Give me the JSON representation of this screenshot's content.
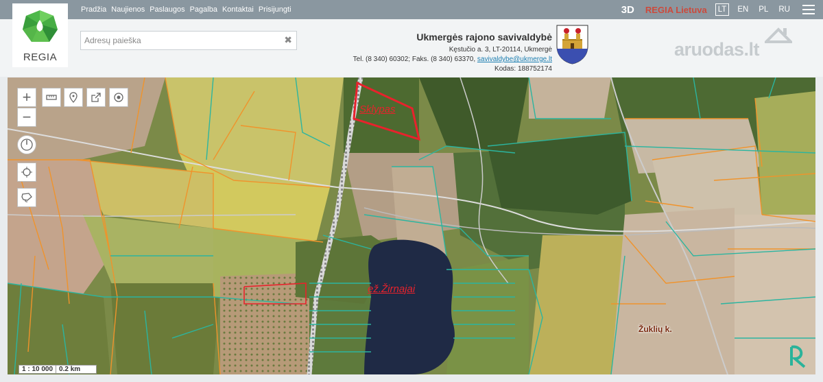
{
  "nav": [
    "Pradžia",
    "Naujienos",
    "Paslaugos",
    "Pagalba",
    "Kontaktai",
    "Prisijungti"
  ],
  "logo": {
    "text": "REGIA"
  },
  "topright": {
    "btn_3d": "3D",
    "regia_lietuva": "REGIA Lietuva",
    "langs": [
      "LT",
      "EN",
      "PL",
      "RU"
    ],
    "active_lang": "LT"
  },
  "search": {
    "placeholder": "Adresų paieška",
    "value": ""
  },
  "municipality": {
    "name": "Ukmergės rajono savivaldybė",
    "address": "Kęstučio a. 3, LT-20114, Ukmergė",
    "phone": "Tel. (8 340) 60302; Faks. (8 340) 63370,",
    "email": "savivaldybe@ukmerge.lt",
    "code": "Kodas: 188752174"
  },
  "partner": {
    "name": "aruodas",
    "tld": ".lt"
  },
  "map": {
    "labels": {
      "plot": "Sklypas",
      "lake": "ež.Žirnajai",
      "village": "Žuklių k."
    },
    "scale": {
      "ratio": "1 : 10 000",
      "distance": "0.2 km"
    },
    "colors": {
      "plot_outline": "#e8222c",
      "parcel_orange": "#f0932b",
      "parcel_teal": "#2bb5a0",
      "lake": "#1f2a45"
    }
  }
}
